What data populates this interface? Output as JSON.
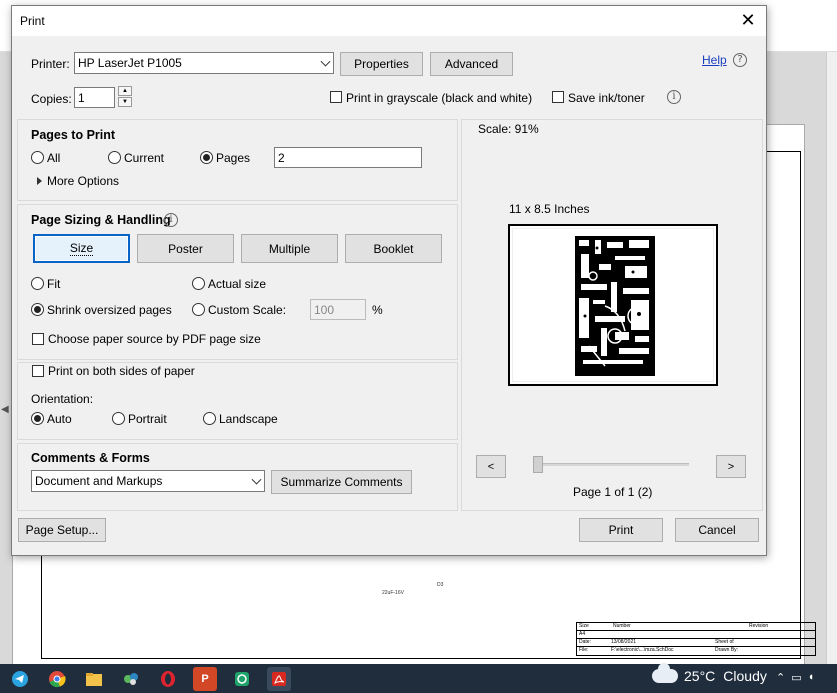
{
  "dialog": {
    "title": "Print",
    "printer_label": "Printer:",
    "printer_value": "HP LaserJet P1005",
    "properties_label": "Properties",
    "advanced_label": "Advanced",
    "help_label": "Help",
    "copies_label": "Copies:",
    "copies_value": "1",
    "grayscale_label": "Print in grayscale (black and white)",
    "save_ink_label": "Save ink/toner",
    "pages_to_print": {
      "heading": "Pages to Print",
      "all_label": "All",
      "current_label": "Current",
      "pages_label": "Pages",
      "pages_value": "2",
      "more_options_label": "More Options",
      "selected": "Pages"
    },
    "sizing": {
      "heading": "Page Sizing & Handling",
      "size_label": "Size",
      "poster_label": "Poster",
      "multiple_label": "Multiple",
      "booklet_label": "Booklet",
      "fit_label": "Fit",
      "actual_size_label": "Actual size",
      "shrink_label": "Shrink oversized pages",
      "custom_scale_label": "Custom Scale:",
      "custom_scale_value": "100",
      "percent_label": "%",
      "paper_source_label": "Choose paper source by PDF page size",
      "selected": "Shrink oversized pages"
    },
    "both_sides_label": "Print on both sides of paper",
    "orientation": {
      "heading": "Orientation:",
      "auto_label": "Auto",
      "portrait_label": "Portrait",
      "landscape_label": "Landscape",
      "selected": "Auto"
    },
    "comments": {
      "heading": "Comments & Forms",
      "value": "Document and Markups",
      "summarize_label": "Summarize Comments"
    },
    "preview": {
      "scale_label": "Scale:  91%",
      "paper_size_label": "11 x 8.5 Inches",
      "prev_label": "<",
      "next_label": ">",
      "page_indicator": "Page 1 of 1 (2)"
    },
    "page_setup_label": "Page Setup...",
    "print_label": "Print",
    "cancel_label": "Cancel"
  },
  "background": {
    "title_block": {
      "size": "Size",
      "number": "Number",
      "revision": "Revision",
      "size_value": "A4",
      "date_label": "Date:",
      "date_value": "13/08/2021",
      "sheet_label": "Sheet   of",
      "file_label": "File:",
      "file_value": "F:\\electronic\\...\\mza.SchDoc",
      "drawn_label": "Drawn By:"
    },
    "component_label": "22uF-16V",
    "diode_label": "D3"
  },
  "taskbar": {
    "weather_temp": "25°C",
    "weather_text": "Cloudy"
  }
}
